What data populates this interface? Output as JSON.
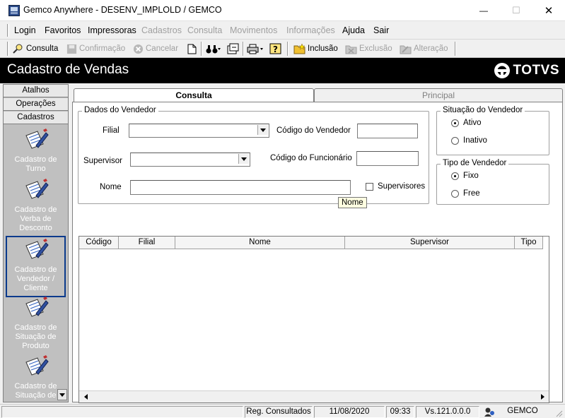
{
  "window": {
    "title": "Gemco Anywhere - DESENV_IMPLOLD / GEMCO",
    "minimize": "—",
    "maximize": "☐",
    "close": "✕"
  },
  "menu": {
    "items": [
      "Login",
      "Favoritos",
      "Impressoras",
      "Cadastros",
      "Consulta",
      "Movimentos",
      "Informações",
      "Ajuda",
      "Sair"
    ]
  },
  "toolbar": {
    "consulta": "Consulta",
    "confirmacao": "Confirmação",
    "cancelar": "Cancelar",
    "inclusao": "Inclusão",
    "exclusao": "Exclusão",
    "alteracao": "Alteração"
  },
  "header": {
    "title": "Cadastro de Vendas",
    "brand": "TOTVS"
  },
  "left_panel": {
    "tabs": [
      "Atalhos",
      "Operações",
      "Cadastros"
    ],
    "items": [
      {
        "label": "Cadastro de Turno"
      },
      {
        "label": "Cadastro de Verba de Desconto"
      },
      {
        "label": "Cadastro de Vendedor / Cliente"
      },
      {
        "label": "Cadastro de Situação de Produto"
      },
      {
        "label": "Cadastro de Situação de"
      }
    ]
  },
  "tabs": {
    "consulta": "Consulta",
    "principal": "Principal"
  },
  "dados_vendedor": {
    "legend": "Dados do Vendedor",
    "filial_label": "Filial",
    "filial_value": "",
    "codigo_vendedor_label": "Código do Vendedor",
    "codigo_vendedor_value": "",
    "supervisor_label": "Supervisor",
    "supervisor_value": "",
    "codigo_funcionario_label": "Código do Funcionário",
    "codigo_funcionario_value": "",
    "nome_label": "Nome",
    "nome_value": "",
    "supervisores_label": "Supervisores",
    "tooltip": "Nome"
  },
  "situacao": {
    "legend": "Situação do Vendedor",
    "options": [
      "Ativo",
      "Inativo"
    ],
    "selected": "Ativo"
  },
  "tipo": {
    "legend": "Tipo de Vendedor",
    "options": [
      "Fixo",
      "Free"
    ],
    "selected": "Fixo"
  },
  "grid": {
    "columns": [
      "Código",
      "Filial",
      "Nome",
      "Supervisor",
      "Tipo"
    ],
    "rows": []
  },
  "status": {
    "reg_label": "Reg. Consultados :",
    "date": "11/08/2020",
    "time": "09:33",
    "version": "Vs.121.0.0.0",
    "company": "GEMCO"
  }
}
